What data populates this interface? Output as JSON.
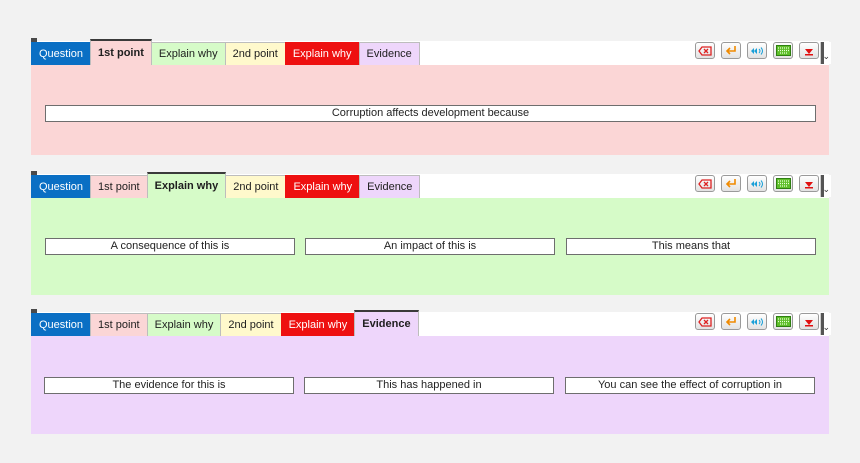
{
  "colors": {
    "question": "#0a6fc4",
    "point1": "#fbd6d6",
    "explain1": "#d6fbc8",
    "point2": "#fff9cc",
    "explain2": "#ee1010",
    "evidence": "#eed6fb",
    "page_bg": "#f2f2f2"
  },
  "icons": [
    "backspace-icon",
    "return-icon",
    "audio-rewind-icon",
    "keyboard-icon",
    "collapse-icon"
  ],
  "panels": [
    {
      "tabs": {
        "question": "Question",
        "point1": "1st point",
        "explain1": "Explain why",
        "point2": "2nd point",
        "explain2": "Explain why",
        "evidence": "Evidence"
      },
      "active": "1st point",
      "fields": [
        "Corruption affects development because"
      ]
    },
    {
      "tabs": {
        "question": "Question",
        "point1": "1st point",
        "explain1": "Explain why",
        "point2": "2nd point",
        "explain2": "Explain why",
        "evidence": "Evidence"
      },
      "active": "Explain why",
      "fields": [
        "A consequence of this is",
        "An impact of this is",
        "This means that"
      ]
    },
    {
      "tabs": {
        "question": "Question",
        "point1": "1st point",
        "explain1": "Explain why",
        "point2": "2nd point",
        "explain2": "Explain why",
        "evidence": "Evidence"
      },
      "active": "Evidence",
      "fields": [
        "The evidence for this is",
        "This has happened in",
        "You can see the effect of corruption in"
      ]
    }
  ]
}
